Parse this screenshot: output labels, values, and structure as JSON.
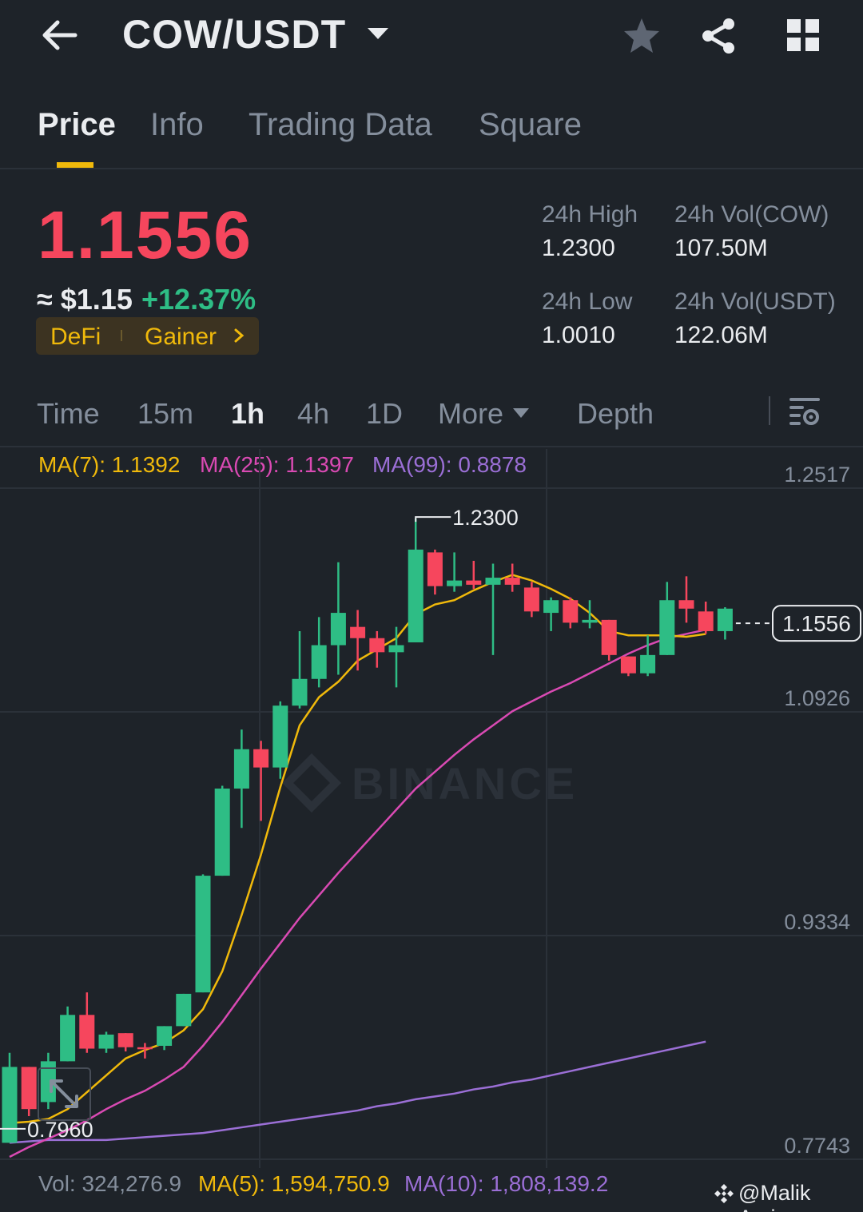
{
  "header": {
    "pair": "COW/USDT",
    "icons": {
      "back": "arrow-left-icon",
      "dropdown": "caret-down-icon",
      "favorite": "star-icon",
      "share": "share-icon",
      "menu": "grid-icon"
    }
  },
  "tabs": [
    {
      "label": "Price",
      "active": true
    },
    {
      "label": "Info",
      "active": false
    },
    {
      "label": "Trading Data",
      "active": false
    },
    {
      "label": "Square",
      "active": false
    }
  ],
  "ticker": {
    "last_price": "1.1556",
    "fiat": "≈ $1.15",
    "change": "+12.37%",
    "tags": [
      "DeFi",
      "Gainer"
    ],
    "stats": {
      "high_label": "24h High",
      "high": "1.2300",
      "vol_base_label": "24h Vol(COW)",
      "vol_base": "107.50M",
      "low_label": "24h Low",
      "low": "1.0010",
      "vol_quote_label": "24h Vol(USDT)",
      "vol_quote": "122.06M"
    }
  },
  "intervals": {
    "items": [
      "Time",
      "15m",
      "1h",
      "4h",
      "1D",
      "More",
      "Depth"
    ],
    "active": "1h"
  },
  "colors": {
    "up": "#2ebd85",
    "down": "#f6465d",
    "accent": "#f0b90b",
    "ma7": "#f0b90b",
    "ma25": "#d94ab3",
    "ma99": "#9b6fd6",
    "bg": "#1e2329"
  },
  "chart_data": {
    "type": "candlestick",
    "ma_legend": {
      "ma7": "MA(7): 1.1392",
      "ma25": "MA(25): 1.1397",
      "ma99": "MA(99): 0.8878"
    },
    "y_ticks": [
      "1.2517",
      "1.0926",
      "0.9334",
      "0.7743"
    ],
    "y_tick_values": [
      1.2517,
      1.0926,
      0.9334,
      0.7743
    ],
    "ylim": [
      0.7743,
      1.2517
    ],
    "current_price": 1.1556,
    "current_price_label": "1.1556",
    "high_marker": {
      "value": 1.23,
      "label": "1.2300"
    },
    "low_marker": {
      "value": 0.796,
      "label": "0.7960"
    },
    "watermark": "BINANCE",
    "candles": [
      {
        "o": 0.786,
        "h": 0.85,
        "l": 0.786,
        "c": 0.84
      },
      {
        "o": 0.84,
        "h": 0.84,
        "l": 0.805,
        "c": 0.81
      },
      {
        "o": 0.815,
        "h": 0.85,
        "l": 0.81,
        "c": 0.844
      },
      {
        "o": 0.844,
        "h": 0.883,
        "l": 0.844,
        "c": 0.877
      },
      {
        "o": 0.877,
        "h": 0.893,
        "l": 0.85,
        "c": 0.853
      },
      {
        "o": 0.853,
        "h": 0.865,
        "l": 0.85,
        "c": 0.863
      },
      {
        "o": 0.864,
        "h": 0.864,
        "l": 0.851,
        "c": 0.854
      },
      {
        "o": 0.854,
        "h": 0.857,
        "l": 0.846,
        "c": 0.853
      },
      {
        "o": 0.855,
        "h": 0.869,
        "l": 0.852,
        "c": 0.869
      },
      {
        "o": 0.869,
        "h": 0.892,
        "l": 0.869,
        "c": 0.892
      },
      {
        "o": 0.893,
        "h": 0.977,
        "l": 0.893,
        "c": 0.976
      },
      {
        "o": 0.976,
        "h": 1.04,
        "l": 0.976,
        "c": 1.038
      },
      {
        "o": 1.038,
        "h": 1.08,
        "l": 1.01,
        "c": 1.066
      },
      {
        "o": 1.066,
        "h": 1.072,
        "l": 1.015,
        "c": 1.053
      },
      {
        "o": 1.053,
        "h": 1.1,
        "l": 1.045,
        "c": 1.097
      },
      {
        "o": 1.097,
        "h": 1.15,
        "l": 1.095,
        "c": 1.116
      },
      {
        "o": 1.116,
        "h": 1.16,
        "l": 1.11,
        "c": 1.14
      },
      {
        "o": 1.14,
        "h": 1.199,
        "l": 1.119,
        "c": 1.163
      },
      {
        "o": 1.153,
        "h": 1.165,
        "l": 1.122,
        "c": 1.145
      },
      {
        "o": 1.145,
        "h": 1.15,
        "l": 1.124,
        "c": 1.135
      },
      {
        "o": 1.135,
        "h": 1.153,
        "l": 1.11,
        "c": 1.14
      },
      {
        "o": 1.142,
        "h": 1.23,
        "l": 1.142,
        "c": 1.208
      },
      {
        "o": 1.206,
        "h": 1.208,
        "l": 1.176,
        "c": 1.182
      },
      {
        "o": 1.182,
        "h": 1.206,
        "l": 1.178,
        "c": 1.186
      },
      {
        "o": 1.186,
        "h": 1.2,
        "l": 1.18,
        "c": 1.183
      },
      {
        "o": 1.183,
        "h": 1.198,
        "l": 1.133,
        "c": 1.188
      },
      {
        "o": 1.188,
        "h": 1.198,
        "l": 1.178,
        "c": 1.183
      },
      {
        "o": 1.181,
        "h": 1.185,
        "l": 1.16,
        "c": 1.164
      },
      {
        "o": 1.163,
        "h": 1.174,
        "l": 1.15,
        "c": 1.172
      },
      {
        "o": 1.172,
        "h": 1.174,
        "l": 1.152,
        "c": 1.156
      },
      {
        "o": 1.156,
        "h": 1.172,
        "l": 1.152,
        "c": 1.158
      },
      {
        "o": 1.158,
        "h": 1.158,
        "l": 1.129,
        "c": 1.133
      },
      {
        "o": 1.132,
        "h": 1.132,
        "l": 1.118,
        "c": 1.12
      },
      {
        "o": 1.12,
        "h": 1.147,
        "l": 1.118,
        "c": 1.133
      },
      {
        "o": 1.133,
        "h": 1.185,
        "l": 1.133,
        "c": 1.172
      },
      {
        "o": 1.172,
        "h": 1.189,
        "l": 1.156,
        "c": 1.166
      },
      {
        "o": 1.164,
        "h": 1.171,
        "l": 1.148,
        "c": 1.15
      },
      {
        "o": 1.15,
        "h": 1.167,
        "l": 1.144,
        "c": 1.166
      }
    ],
    "ma7_line": [
      [
        0.8,
        0.801,
        0.803,
        0.81,
        0.822,
        0.834,
        0.846,
        0.852,
        0.857,
        0.866,
        0.881,
        0.908,
        0.948,
        0.991,
        1.039,
        1.083,
        1.103,
        1.114,
        1.129,
        1.137,
        1.145,
        1.162,
        1.169,
        1.172,
        1.179,
        1.185,
        1.19,
        1.186,
        1.18,
        1.173,
        1.163,
        1.15,
        1.147,
        1.147,
        1.147,
        1.146,
        1.148
      ]
    ],
    "ma25_line": [
      0.776,
      0.783,
      0.789,
      0.795,
      0.802,
      0.81,
      0.817,
      0.823,
      0.831,
      0.84,
      0.855,
      0.872,
      0.891,
      0.91,
      0.928,
      0.946,
      0.962,
      0.978,
      0.993,
      1.008,
      1.023,
      1.038,
      1.05,
      1.062,
      1.073,
      1.083,
      1.093,
      1.1,
      1.107,
      1.113,
      1.12,
      1.127,
      1.134,
      1.14,
      1.145,
      1.148,
      1.151
    ],
    "ma99_line": [
      0.786,
      0.787,
      0.788,
      0.788,
      0.788,
      0.788,
      0.789,
      0.79,
      0.791,
      0.792,
      0.793,
      0.795,
      0.797,
      0.799,
      0.801,
      0.803,
      0.805,
      0.807,
      0.809,
      0.812,
      0.814,
      0.817,
      0.819,
      0.821,
      0.824,
      0.826,
      0.829,
      0.831,
      0.834,
      0.837,
      0.84,
      0.843,
      0.846,
      0.849,
      0.852,
      0.855,
      0.858
    ],
    "vol_legend": {
      "vol": "Vol: 324,276.9",
      "ma5": "MA(5): 1,594,750.9",
      "ma10": "MA(10): 1,808,139.2"
    }
  },
  "footer": {
    "handle": "@Malik Amin"
  }
}
